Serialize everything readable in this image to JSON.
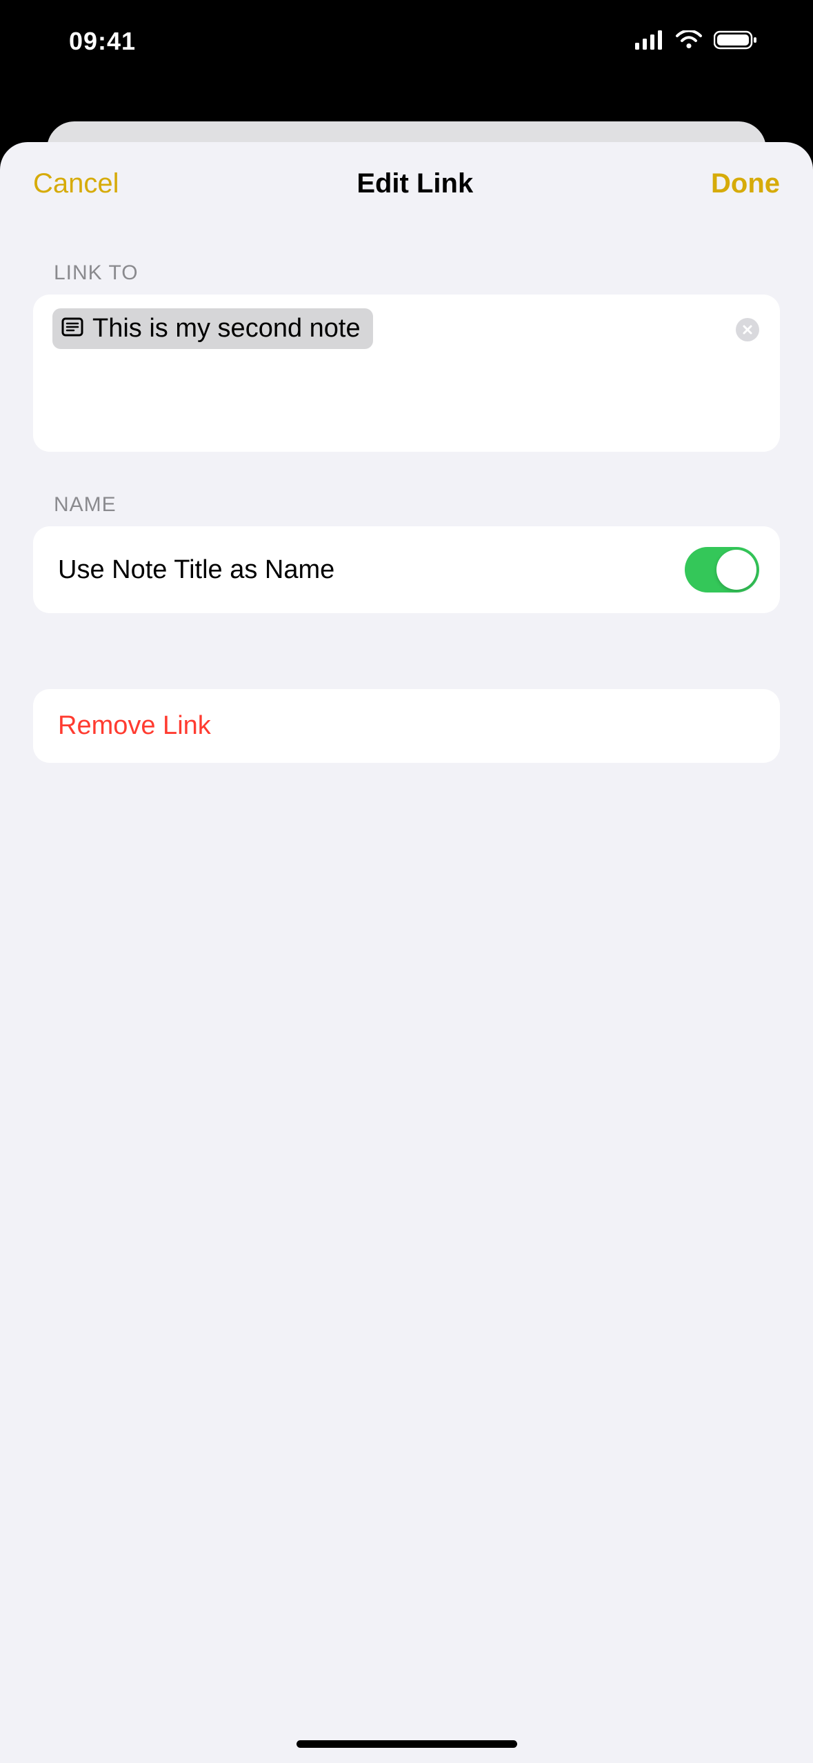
{
  "status": {
    "time": "09:41"
  },
  "sheet": {
    "cancel_label": "Cancel",
    "title": "Edit Link",
    "done_label": "Done",
    "link_to": {
      "header": "Link To",
      "chip_label": "This is my second note"
    },
    "name_section": {
      "header": "Name",
      "row_label": "Use Note Title as Name",
      "toggle_on": true
    },
    "remove": {
      "label": "Remove Link"
    }
  },
  "colors": {
    "accent": "#d6ab0a",
    "destructive": "#ff3b30",
    "toggle_on": "#34c759",
    "sheet_bg": "#f2f2f7",
    "card_bg": "#ffffff"
  }
}
